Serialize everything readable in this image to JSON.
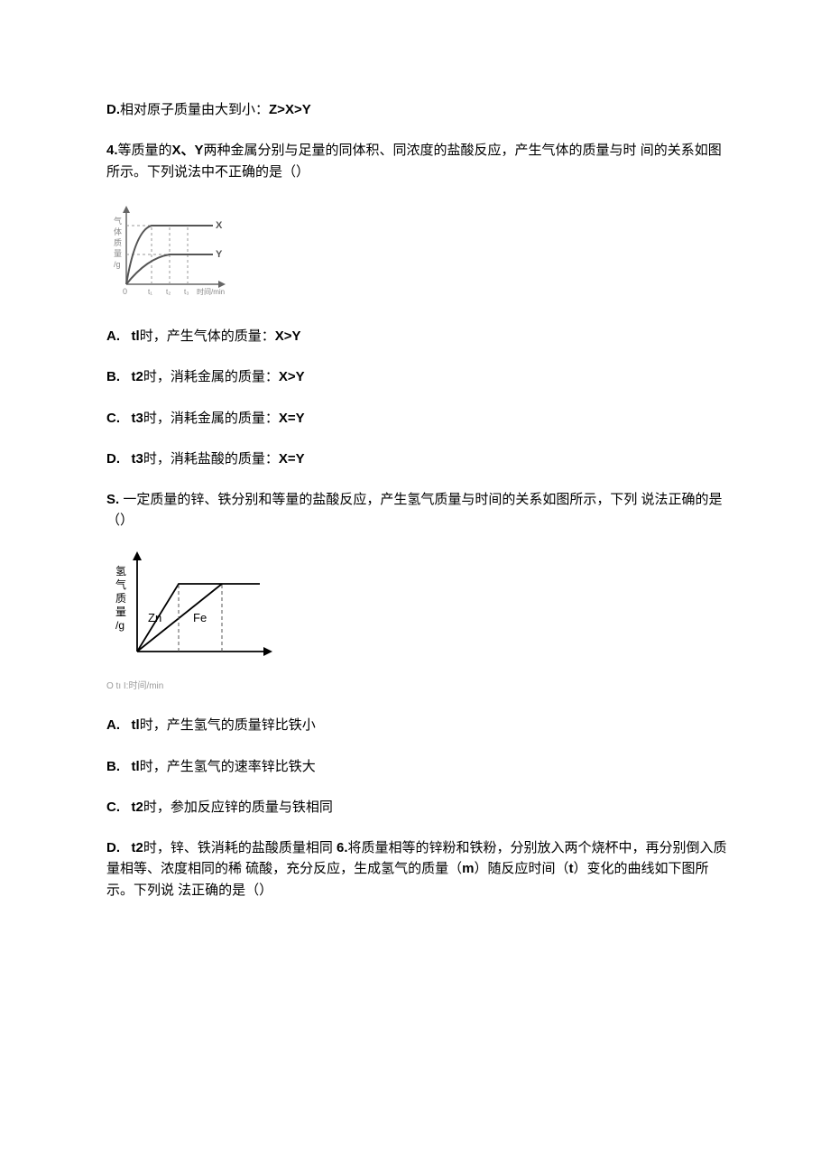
{
  "line_d_prev": {
    "label": "D.",
    "text": "相对原子质量由大到小：",
    "expr": "Z>X>Y"
  },
  "q4": {
    "stem_part1": "4.",
    "stem_part2": "等质量的",
    "stem_bold1": "X、Y",
    "stem_part3": "两种金属分别与足量的同体积、同浓度的盐酸反应，产生气体的质量与时 间的关系如图所示。下列说法中不正确的是（）"
  },
  "q4_opts": {
    "a": {
      "label": "A.",
      "b": "tl",
      "text": "时，产生气体的质量：",
      "expr": "X>Y"
    },
    "b": {
      "label": "B.",
      "b": "t2",
      "text": "时，消耗金属的质量：",
      "expr": "X>Y"
    },
    "c": {
      "label": "C.",
      "b": "t3",
      "text": "时，消耗金属的质量：",
      "expr": "X=Y"
    },
    "d": {
      "label": "D.",
      "b": "t3",
      "text": "时，消耗盐酸的质量：",
      "expr": "X=Y"
    }
  },
  "q5": {
    "label": "S.",
    "text": "  一定质量的锌、铁分别和等量的盐酸反应，产生氢气质量与时间的关系如图所示，下列 说法正确的是（）"
  },
  "q5_fig": {
    "ylabel_1": "氢",
    "ylabel_2": "气",
    "ylabel_3": "质",
    "ylabel_4": "量",
    "ylabel_5": "/g",
    "zn": "Zn",
    "fe": "Fe",
    "xaxis": "O tı I:时间/min"
  },
  "q5_opts": {
    "a": {
      "label": "A.",
      "b": "tl",
      "text": "时，产生氢气的质量锌比铁小"
    },
    "b": {
      "label": "B.",
      "b": "tl",
      "text": "时，产生氢气的速率锌比铁大"
    },
    "c": {
      "label": "C.",
      "b": "t2",
      "text": "时，参加反应锌的质量与铁相同"
    },
    "d": {
      "label": "D.",
      "b": "t2",
      "text": "时，锌、铁消耗的盐酸质量相同 ",
      "q6_label": "6.",
      "q6_text_a": "将质量相等的锌粉和铁粉，分别放入两个烧杯中，再分别倒入质量相等、浓度相同的稀 硫酸，充分反应，生成氢气的质量（",
      "q6_b1": "m",
      "q6_text_b": "）随反应时间（",
      "q6_b2": "t",
      "q6_text_c": "）变化的曲线如下图所示。下列说 法正确的是（）"
    }
  },
  "chart_data": [
    {
      "type": "line",
      "title": "",
      "xlabel": "时间/min",
      "ylabel": "气体质量/g",
      "x_ticks": [
        "t1",
        "t2",
        "t3"
      ],
      "series": [
        {
          "name": "X",
          "style": "rises quickly then plateaus high"
        },
        {
          "name": "Y",
          "style": "rises slower then plateaus low"
        }
      ],
      "note": "Both start at origin; X levels off higher than Y; dashed verticals at t1,t2,t3"
    },
    {
      "type": "line",
      "title": "",
      "xlabel": "时间/min",
      "ylabel": "氢气质量/g",
      "x_ticks": [
        "t1",
        "t2"
      ],
      "series": [
        {
          "name": "Zn",
          "style": "steeper, reaches plateau first"
        },
        {
          "name": "Fe",
          "style": "less steep, reaches same plateau later"
        }
      ],
      "note": "Zn and Fe both start at origin and end at same height; dashed verticals at t1,t2"
    }
  ]
}
